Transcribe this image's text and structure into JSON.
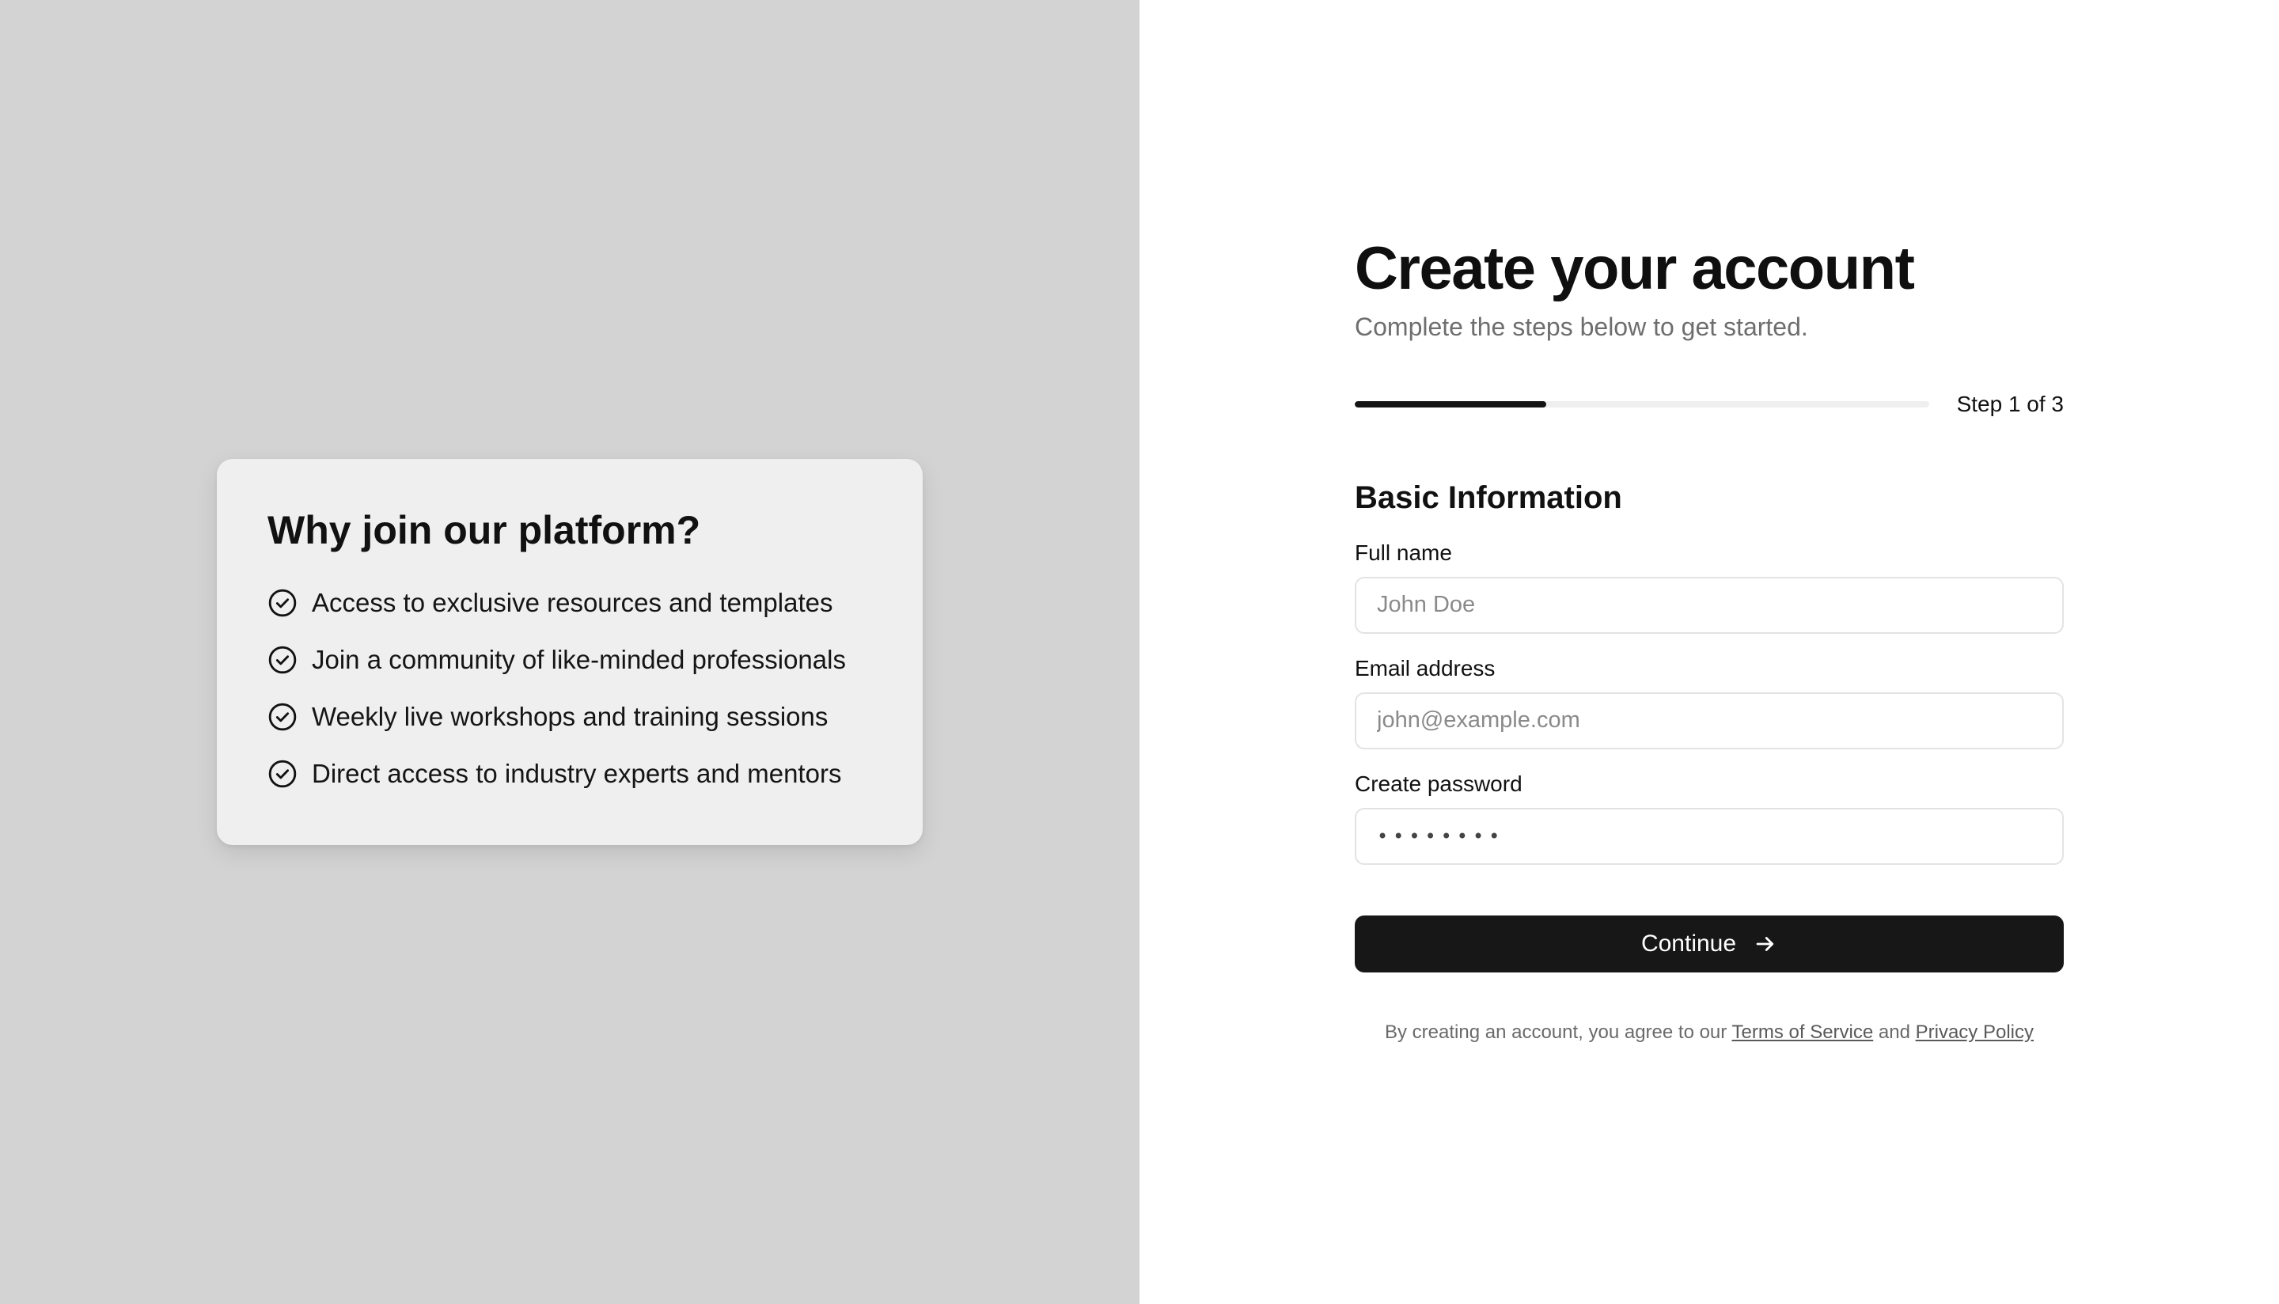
{
  "benefits": {
    "title": "Why join our platform?",
    "items": [
      {
        "icon": "check-circle-icon",
        "text": "Access to exclusive resources and templates"
      },
      {
        "icon": "check-circle-icon",
        "text": "Join a community of like-minded professionals"
      },
      {
        "icon": "check-circle-icon",
        "text": "Weekly live workshops and training sessions"
      },
      {
        "icon": "check-circle-icon",
        "text": "Direct access to industry experts and mentors"
      }
    ]
  },
  "form": {
    "title": "Create your account",
    "subtitle": "Complete the steps below to get started.",
    "progress": {
      "current_step": 1,
      "total_steps": 3,
      "label": "Step 1 of 3"
    },
    "section_title": "Basic Information",
    "fields": {
      "full_name": {
        "label": "Full name",
        "placeholder": "John Doe",
        "value": ""
      },
      "email": {
        "label": "Email address",
        "placeholder": "john@example.com",
        "value": ""
      },
      "password": {
        "label": "Create password",
        "value": "••••••••"
      }
    },
    "continue_label": "Continue",
    "terms": {
      "prefix": "By creating an account, you agree to our",
      "terms_link": "Terms of Service",
      "conjunction": "and",
      "privacy_link": "Privacy Policy"
    }
  },
  "colors": {
    "left_background": "#d3d3d3",
    "card_background": "#efefef",
    "right_background": "#ffffff",
    "primary": "#171717",
    "muted_text": "#6e6e6e"
  }
}
